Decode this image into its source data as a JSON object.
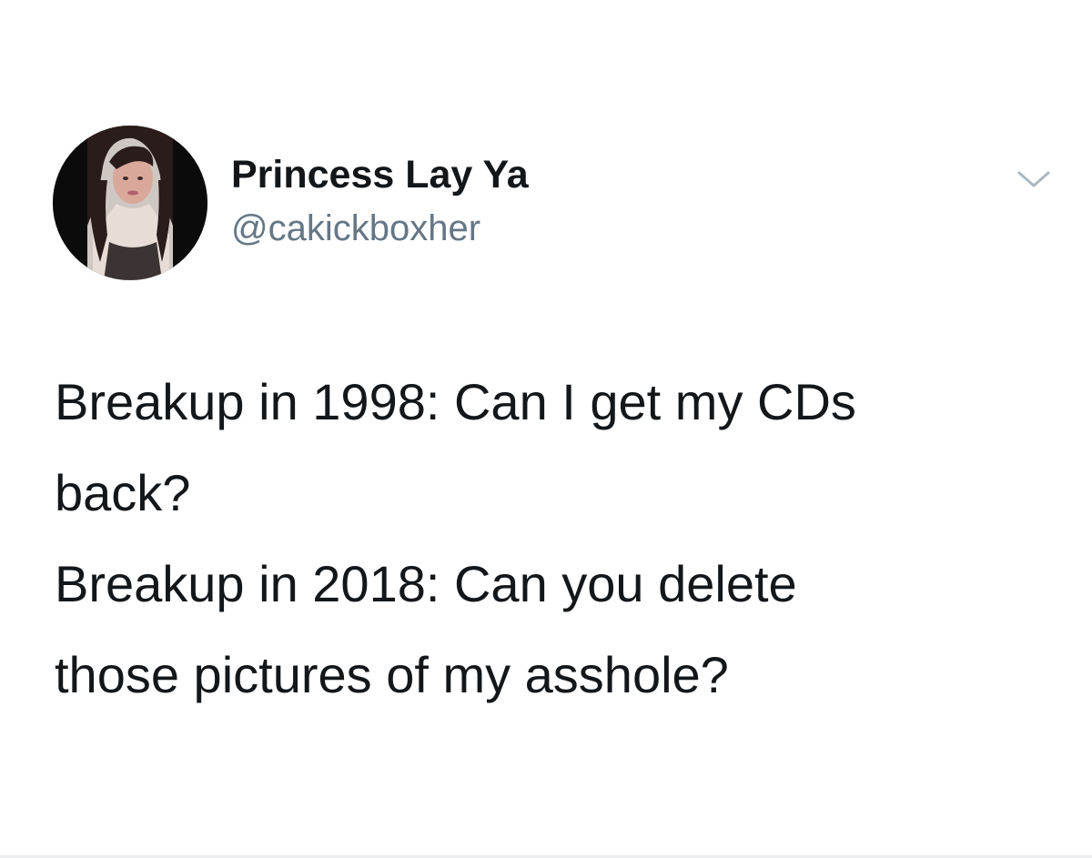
{
  "author": {
    "display_name": "Princess Lay Ya",
    "handle": "@cakickboxher",
    "avatar_icon": "profile-photo"
  },
  "menu": {
    "icon": "chevron-down-icon"
  },
  "tweet": {
    "lines": [
      "Breakup in 1998: Can I get my CDs",
      "back?",
      "Breakup in 2018: Can you delete",
      "those pictures of my asshole?"
    ]
  },
  "colors": {
    "text": "#14171a",
    "handle": "#657786",
    "background": "#ffffff",
    "caret": "#aab8c2"
  }
}
